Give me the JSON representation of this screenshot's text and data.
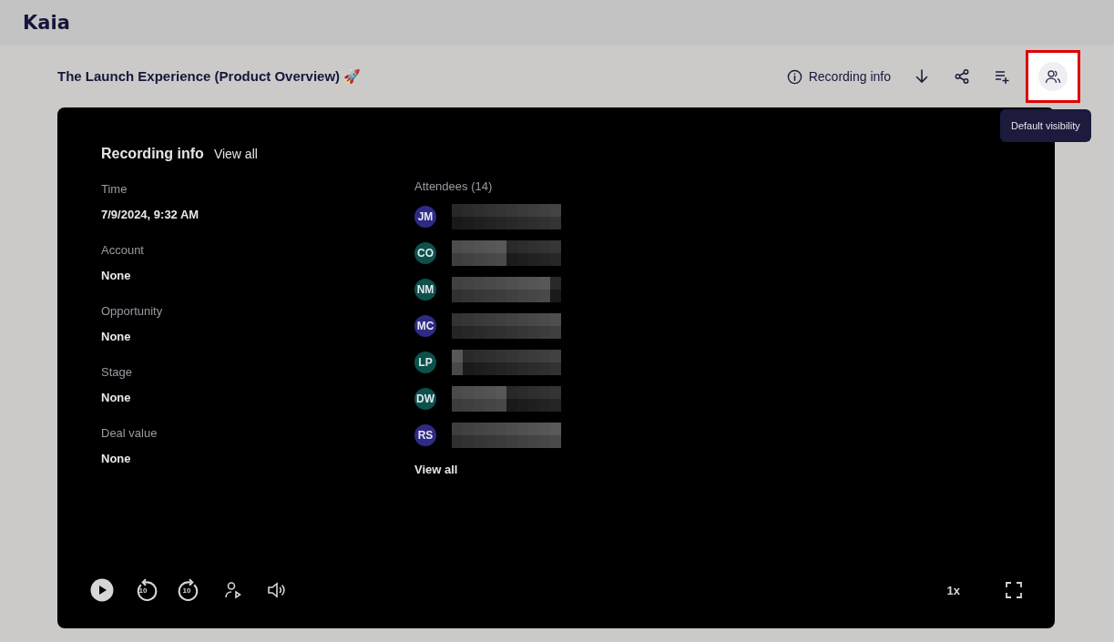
{
  "app": {
    "name": "Kaia"
  },
  "recording": {
    "title": "The Launch Experience (Product Overview) 🚀"
  },
  "toolbar": [
    {
      "kind": "info",
      "label": "Recording info"
    },
    {
      "kind": "download"
    },
    {
      "kind": "share"
    },
    {
      "kind": "playlist"
    },
    {
      "kind": "people",
      "highlighted": true,
      "tooltip": "Default visibility"
    }
  ],
  "info_panel": {
    "title": "Recording info",
    "view_all": "View all",
    "fields": [
      {
        "label": "Time",
        "value": "7/9/2024, 9:32 AM"
      },
      {
        "label": "Account",
        "value": "None"
      },
      {
        "label": "Opportunity",
        "value": "None"
      },
      {
        "label": "Stage",
        "value": "None"
      },
      {
        "label": "Deal value",
        "value": "None"
      }
    ],
    "attendees_heading": "Attendees (14)",
    "attendees": [
      {
        "initials": "JM",
        "color": "#2e2b85"
      },
      {
        "initials": "CO",
        "color": "#0c514b"
      },
      {
        "initials": "NM",
        "color": "#0c514b"
      },
      {
        "initials": "MC",
        "color": "#2e2b85"
      },
      {
        "initials": "LP",
        "color": "#0c514b"
      },
      {
        "initials": "DW",
        "color": "#0c514b"
      },
      {
        "initials": "RS",
        "color": "#2e2b85"
      }
    ],
    "attendees_view_all": "View all"
  },
  "player": {
    "controls": [
      {
        "kind": "play"
      },
      {
        "kind": "back",
        "label": "10"
      },
      {
        "kind": "forward",
        "label": "10"
      },
      {
        "kind": "speaker"
      },
      {
        "kind": "volume"
      }
    ],
    "speed": "1x"
  }
}
